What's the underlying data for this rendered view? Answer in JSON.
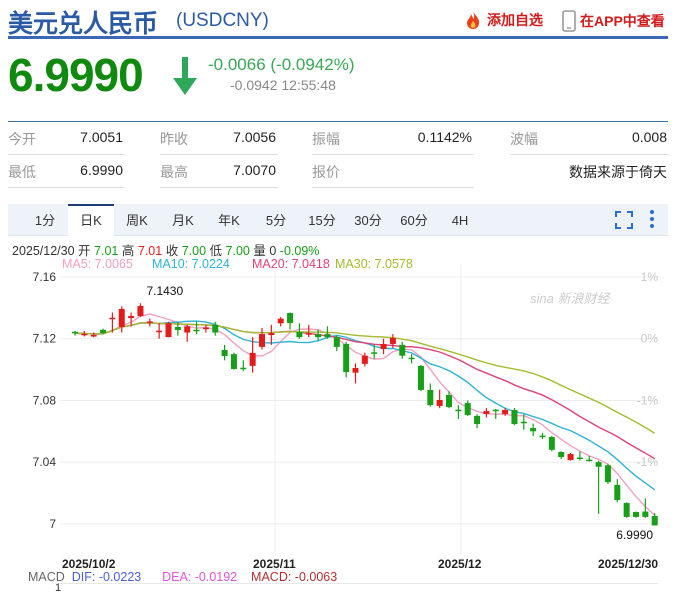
{
  "header": {
    "title": "美元兑人民币",
    "code": "(USDCNY)",
    "add_watchlist": "添加自选",
    "view_in_app": "在APP中查看",
    "icons": {
      "watchlist": "flame-icon",
      "app": "phone-icon"
    }
  },
  "quote": {
    "price": "6.9990",
    "direction": "down",
    "change": "-0.0066 (-0.0942%)",
    "sub": "-0.0942 12:55:48",
    "colors": {
      "price": "#0f8a0f",
      "change": "#3aa755"
    }
  },
  "stats": [
    {
      "label": "今开",
      "value": "7.0051"
    },
    {
      "label": "昨收",
      "value": "7.0056"
    },
    {
      "label": "振幅",
      "value": "0.1142%"
    },
    {
      "label": "波幅",
      "value": "0.008"
    },
    {
      "label": "最低",
      "value": "6.9990"
    },
    {
      "label": "最高",
      "value": "7.0070"
    },
    {
      "label": "报价",
      "value": ""
    },
    {
      "label": "",
      "value": "数据来源于倚天"
    }
  ],
  "tabs": [
    {
      "label": "1分"
    },
    {
      "label": "日K",
      "active": true
    },
    {
      "label": "周K"
    },
    {
      "label": "月K"
    },
    {
      "label": "年K"
    },
    {
      "label": "5分"
    },
    {
      "label": "15分"
    },
    {
      "label": "30分"
    },
    {
      "label": "60分"
    },
    {
      "label": "4H"
    }
  ],
  "toolbar": {
    "fullscreen_icon": "fullscreen-icon",
    "more_icon": "more-vertical-icon"
  },
  "info": {
    "date": "2025/12/30",
    "open_label": "开",
    "open": "7.01",
    "high_label": "高",
    "high": "7.01",
    "close_label": "收",
    "close": "7.00",
    "low_label": "低",
    "low": "7.00",
    "vol_label": "量",
    "vol": "0",
    "pct": "-0.09%"
  },
  "ma_legend": [
    {
      "text": "MA5: 7.0065",
      "color": "#f0a0c0"
    },
    {
      "text": "MA10: 7.0224",
      "color": "#2fb3d6"
    },
    {
      "text": "MA20: 7.0418",
      "color": "#e0417a"
    },
    {
      "text": "MA30: 7.0578",
      "color": "#a4bc2e"
    }
  ],
  "watermark": "sina 新浪财经",
  "chart_data": {
    "type": "candlestick",
    "ylim": [
      7.0,
      7.16
    ],
    "y_ticks": [
      "7.16",
      "7.12",
      "7.08",
      "7.04",
      "7"
    ],
    "right_ticks": [
      "1%",
      "0%",
      "-1%",
      "-1%"
    ],
    "x_labels": [
      "2025/10/2",
      "2025/11",
      "2025/12",
      "2025/12/30"
    ],
    "max_label": "7.1430",
    "last_label": "6.9990",
    "up_color": "#e41b1b",
    "down_color": "#17a017",
    "ma_periods": [
      5,
      10,
      20,
      30
    ],
    "grid": true,
    "candles": [
      [
        7.1245,
        7.125,
        7.122,
        7.1235
      ],
      [
        7.123,
        7.125,
        7.1215,
        7.1232
      ],
      [
        7.1222,
        7.124,
        7.121,
        7.1224
      ],
      [
        7.1257,
        7.1265,
        7.123,
        7.1237
      ],
      [
        7.133,
        7.137,
        7.124,
        7.1336
      ],
      [
        7.1276,
        7.141,
        7.124,
        7.1393
      ],
      [
        7.1334,
        7.137,
        7.128,
        7.1347
      ],
      [
        7.1347,
        7.143,
        7.134,
        7.1412
      ],
      [
        7.1308,
        7.133,
        7.128,
        7.1312
      ],
      [
        7.1248,
        7.13,
        7.12,
        7.1252
      ],
      [
        7.121,
        7.131,
        7.121,
        7.13
      ],
      [
        7.1276,
        7.131,
        7.122,
        7.1257
      ],
      [
        7.124,
        7.129,
        7.118,
        7.128
      ],
      [
        7.1258,
        7.131,
        7.123,
        7.1255
      ],
      [
        7.1268,
        7.129,
        7.124,
        7.1272
      ],
      [
        7.129,
        7.131,
        7.122,
        7.124
      ],
      [
        7.1127,
        7.116,
        7.106,
        7.1088
      ],
      [
        7.11,
        7.111,
        7.1,
        7.1004
      ],
      [
        7.1012,
        7.106,
        7.099,
        7.1008
      ],
      [
        7.1024,
        7.121,
        7.098,
        7.1108
      ],
      [
        7.1147,
        7.127,
        7.113,
        7.123
      ],
      [
        7.1224,
        7.129,
        7.116,
        7.1237
      ],
      [
        7.13,
        7.134,
        7.128,
        7.133
      ],
      [
        7.1367,
        7.137,
        7.126,
        7.1302
      ],
      [
        7.1244,
        7.13,
        7.12,
        7.121
      ],
      [
        7.1232,
        7.129,
        7.121,
        7.1236
      ],
      [
        7.123,
        7.126,
        7.119,
        7.121
      ],
      [
        7.123,
        7.128,
        7.12,
        7.121
      ],
      [
        7.121,
        7.122,
        7.112,
        7.1147
      ],
      [
        7.1166,
        7.118,
        7.095,
        7.0984
      ],
      [
        7.098,
        7.104,
        7.091,
        7.101
      ],
      [
        7.1037,
        7.111,
        7.102,
        7.109
      ],
      [
        7.1112,
        7.116,
        7.107,
        7.1108
      ],
      [
        7.1133,
        7.12,
        7.11,
        7.1166
      ],
      [
        7.1166,
        7.123,
        7.114,
        7.1205
      ],
      [
        7.116,
        7.118,
        7.107,
        7.109
      ],
      [
        7.1077,
        7.11,
        7.104,
        7.1073
      ],
      [
        7.1024,
        7.103,
        7.086,
        7.0868
      ],
      [
        7.0868,
        7.091,
        7.076,
        7.077
      ],
      [
        7.0764,
        7.087,
        7.075,
        7.0803
      ],
      [
        7.0835,
        7.086,
        7.075,
        7.0757
      ],
      [
        7.074,
        7.077,
        7.068,
        7.0736
      ],
      [
        7.0783,
        7.08,
        7.07,
        7.0705
      ],
      [
        7.07,
        7.071,
        7.062,
        7.0647
      ],
      [
        7.0712,
        7.075,
        7.069,
        7.0731
      ],
      [
        7.074,
        7.0745,
        7.068,
        7.0736
      ],
      [
        7.0712,
        7.075,
        7.07,
        7.0738
      ],
      [
        7.0738,
        7.0751,
        7.064,
        7.0647
      ],
      [
        7.0662,
        7.071,
        7.061,
        7.0658
      ],
      [
        7.0621,
        7.065,
        7.057,
        7.06
      ],
      [
        7.0572,
        7.059,
        7.055,
        7.0568
      ],
      [
        7.0563,
        7.057,
        7.047,
        7.048
      ],
      [
        7.0466,
        7.047,
        7.042,
        7.0433
      ],
      [
        7.0414,
        7.046,
        7.041,
        7.0453
      ],
      [
        7.043,
        7.047,
        7.041,
        7.0425
      ],
      [
        7.0416,
        7.044,
        7.0405,
        7.0413
      ],
      [
        7.04,
        7.041,
        7.0065,
        7.037
      ],
      [
        7.038,
        7.039,
        7.026,
        7.027
      ],
      [
        7.0252,
        7.029,
        7.014,
        7.0155
      ],
      [
        7.0135,
        7.014,
        7.004,
        7.0045
      ],
      [
        7.0077,
        7.008,
        7.004,
        7.0045
      ],
      [
        7.008,
        7.0165,
        7.004,
        7.0045
      ],
      [
        7.0051,
        7.007,
        6.999,
        6.999
      ]
    ]
  },
  "macd": {
    "label": "MACD",
    "dif": "DIF: -0.0223",
    "dea": "DEA: -0.0192",
    "macd": "MACD: -0.0063",
    "colors": {
      "dif": "#4a5fd6",
      "dea": "#e053d8",
      "macd": "#b03030"
    },
    "axis_top": "1"
  }
}
